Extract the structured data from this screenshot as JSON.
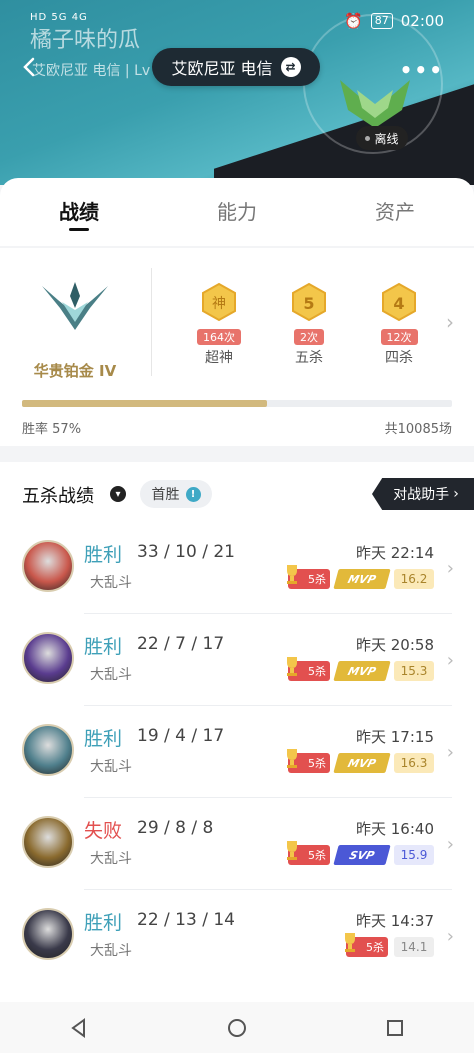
{
  "status_bar": {
    "network_text": "HD 5G 4G",
    "battery": "87",
    "time": "02:00"
  },
  "header": {
    "watermark": "橘子味的瓜",
    "sub_region": "艾欧尼亚 电信 | Lv",
    "server": "艾欧尼亚 电信",
    "status": "离线"
  },
  "tabs": [
    {
      "label": "战绩",
      "active": true
    },
    {
      "label": "能力",
      "active": false
    },
    {
      "label": "资产",
      "active": false
    }
  ],
  "rank": {
    "tier": "华贵铂金 IV",
    "badges": [
      {
        "glyph": "神",
        "count": "164次",
        "label": "超神"
      },
      {
        "glyph": "5",
        "count": "2次",
        "label": "五杀"
      },
      {
        "glyph": "4",
        "count": "12次",
        "label": "四杀"
      }
    ],
    "win_rate_label": "胜率",
    "win_rate_text": "57%",
    "win_rate": 0.57,
    "total": "共10085场"
  },
  "pentakill": {
    "title": "五杀战绩",
    "first_win": "首胜",
    "assist": "对战助手",
    "matches": [
      {
        "result": "胜利",
        "win": true,
        "kda": "33 / 10 / 21",
        "mode": "大乱斗",
        "time": "昨天 22:14",
        "penta": "5杀",
        "mvp": "MVP",
        "mvp_color": "#e2b93a",
        "score": "16.2",
        "score_bg": "#fbe9b8",
        "score_fg": "#a9842b",
        "champ_color": "#c9574b"
      },
      {
        "result": "胜利",
        "win": true,
        "kda": "22 / 7 / 17",
        "mode": "大乱斗",
        "time": "昨天 20:58",
        "penta": "5杀",
        "mvp": "MVP",
        "mvp_color": "#e2b93a",
        "score": "15.3",
        "score_bg": "#fbe9b8",
        "score_fg": "#a9842b",
        "champ_color": "#5a3c8f"
      },
      {
        "result": "胜利",
        "win": true,
        "kda": "19 / 4 / 17",
        "mode": "大乱斗",
        "time": "昨天 17:15",
        "penta": "5杀",
        "mvp": "MVP",
        "mvp_color": "#e2b93a",
        "score": "16.3",
        "score_bg": "#fbe9b8",
        "score_fg": "#a9842b",
        "champ_color": "#4f7f8c"
      },
      {
        "result": "失败",
        "win": false,
        "kda": "29 / 8 / 8",
        "mode": "大乱斗",
        "time": "昨天 16:40",
        "penta": "5杀",
        "mvp": "SVP",
        "mvp_color": "#4b58d6",
        "score": "15.9",
        "score_bg": "#e6e8fb",
        "score_fg": "#4b58d6",
        "champ_color": "#8a6a2e"
      },
      {
        "result": "胜利",
        "win": true,
        "kda": "22 / 13 / 14",
        "mode": "大乱斗",
        "time": "昨天 14:37",
        "penta": "5杀",
        "mvp": "",
        "mvp_color": "",
        "score": "14.1",
        "score_bg": "#eeeeee",
        "score_fg": "#888888",
        "champ_color": "#3a3a4a"
      }
    ]
  },
  "colors": {
    "win": "#3fa0b8",
    "loss": "#e2504f",
    "gold": "#a78a4a"
  }
}
